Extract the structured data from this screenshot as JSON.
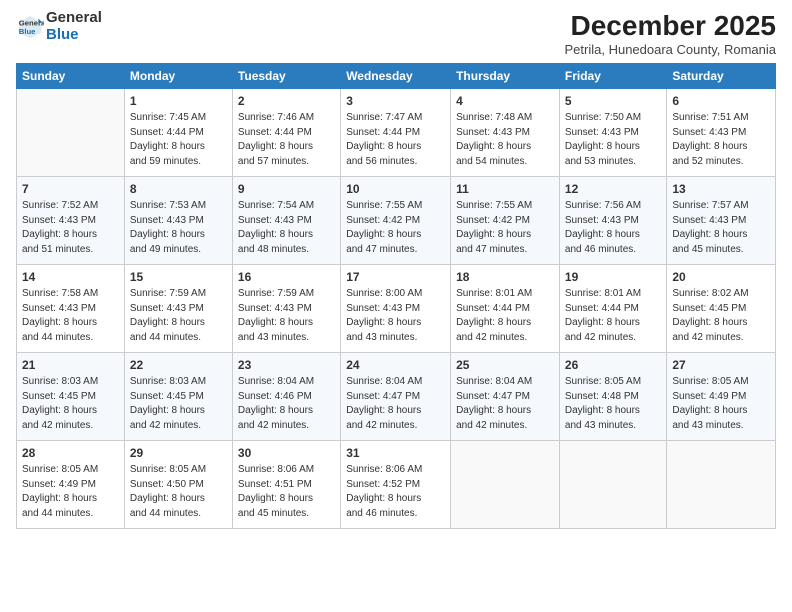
{
  "logo": {
    "line1": "General",
    "line2": "Blue"
  },
  "title": "December 2025",
  "subtitle": "Petrila, Hunedoara County, Romania",
  "days_header": [
    "Sunday",
    "Monday",
    "Tuesday",
    "Wednesday",
    "Thursday",
    "Friday",
    "Saturday"
  ],
  "weeks": [
    [
      {
        "day": "",
        "info": ""
      },
      {
        "day": "1",
        "info": "Sunrise: 7:45 AM\nSunset: 4:44 PM\nDaylight: 8 hours\nand 59 minutes."
      },
      {
        "day": "2",
        "info": "Sunrise: 7:46 AM\nSunset: 4:44 PM\nDaylight: 8 hours\nand 57 minutes."
      },
      {
        "day": "3",
        "info": "Sunrise: 7:47 AM\nSunset: 4:44 PM\nDaylight: 8 hours\nand 56 minutes."
      },
      {
        "day": "4",
        "info": "Sunrise: 7:48 AM\nSunset: 4:43 PM\nDaylight: 8 hours\nand 54 minutes."
      },
      {
        "day": "5",
        "info": "Sunrise: 7:50 AM\nSunset: 4:43 PM\nDaylight: 8 hours\nand 53 minutes."
      },
      {
        "day": "6",
        "info": "Sunrise: 7:51 AM\nSunset: 4:43 PM\nDaylight: 8 hours\nand 52 minutes."
      }
    ],
    [
      {
        "day": "7",
        "info": "Sunrise: 7:52 AM\nSunset: 4:43 PM\nDaylight: 8 hours\nand 51 minutes."
      },
      {
        "day": "8",
        "info": "Sunrise: 7:53 AM\nSunset: 4:43 PM\nDaylight: 8 hours\nand 49 minutes."
      },
      {
        "day": "9",
        "info": "Sunrise: 7:54 AM\nSunset: 4:43 PM\nDaylight: 8 hours\nand 48 minutes."
      },
      {
        "day": "10",
        "info": "Sunrise: 7:55 AM\nSunset: 4:42 PM\nDaylight: 8 hours\nand 47 minutes."
      },
      {
        "day": "11",
        "info": "Sunrise: 7:55 AM\nSunset: 4:42 PM\nDaylight: 8 hours\nand 47 minutes."
      },
      {
        "day": "12",
        "info": "Sunrise: 7:56 AM\nSunset: 4:43 PM\nDaylight: 8 hours\nand 46 minutes."
      },
      {
        "day": "13",
        "info": "Sunrise: 7:57 AM\nSunset: 4:43 PM\nDaylight: 8 hours\nand 45 minutes."
      }
    ],
    [
      {
        "day": "14",
        "info": "Sunrise: 7:58 AM\nSunset: 4:43 PM\nDaylight: 8 hours\nand 44 minutes."
      },
      {
        "day": "15",
        "info": "Sunrise: 7:59 AM\nSunset: 4:43 PM\nDaylight: 8 hours\nand 44 minutes."
      },
      {
        "day": "16",
        "info": "Sunrise: 7:59 AM\nSunset: 4:43 PM\nDaylight: 8 hours\nand 43 minutes."
      },
      {
        "day": "17",
        "info": "Sunrise: 8:00 AM\nSunset: 4:43 PM\nDaylight: 8 hours\nand 43 minutes."
      },
      {
        "day": "18",
        "info": "Sunrise: 8:01 AM\nSunset: 4:44 PM\nDaylight: 8 hours\nand 42 minutes."
      },
      {
        "day": "19",
        "info": "Sunrise: 8:01 AM\nSunset: 4:44 PM\nDaylight: 8 hours\nand 42 minutes."
      },
      {
        "day": "20",
        "info": "Sunrise: 8:02 AM\nSunset: 4:45 PM\nDaylight: 8 hours\nand 42 minutes."
      }
    ],
    [
      {
        "day": "21",
        "info": "Sunrise: 8:03 AM\nSunset: 4:45 PM\nDaylight: 8 hours\nand 42 minutes."
      },
      {
        "day": "22",
        "info": "Sunrise: 8:03 AM\nSunset: 4:45 PM\nDaylight: 8 hours\nand 42 minutes."
      },
      {
        "day": "23",
        "info": "Sunrise: 8:04 AM\nSunset: 4:46 PM\nDaylight: 8 hours\nand 42 minutes."
      },
      {
        "day": "24",
        "info": "Sunrise: 8:04 AM\nSunset: 4:47 PM\nDaylight: 8 hours\nand 42 minutes."
      },
      {
        "day": "25",
        "info": "Sunrise: 8:04 AM\nSunset: 4:47 PM\nDaylight: 8 hours\nand 42 minutes."
      },
      {
        "day": "26",
        "info": "Sunrise: 8:05 AM\nSunset: 4:48 PM\nDaylight: 8 hours\nand 43 minutes."
      },
      {
        "day": "27",
        "info": "Sunrise: 8:05 AM\nSunset: 4:49 PM\nDaylight: 8 hours\nand 43 minutes."
      }
    ],
    [
      {
        "day": "28",
        "info": "Sunrise: 8:05 AM\nSunset: 4:49 PM\nDaylight: 8 hours\nand 44 minutes."
      },
      {
        "day": "29",
        "info": "Sunrise: 8:05 AM\nSunset: 4:50 PM\nDaylight: 8 hours\nand 44 minutes."
      },
      {
        "day": "30",
        "info": "Sunrise: 8:06 AM\nSunset: 4:51 PM\nDaylight: 8 hours\nand 45 minutes."
      },
      {
        "day": "31",
        "info": "Sunrise: 8:06 AM\nSunset: 4:52 PM\nDaylight: 8 hours\nand 46 minutes."
      },
      {
        "day": "",
        "info": ""
      },
      {
        "day": "",
        "info": ""
      },
      {
        "day": "",
        "info": ""
      }
    ]
  ]
}
